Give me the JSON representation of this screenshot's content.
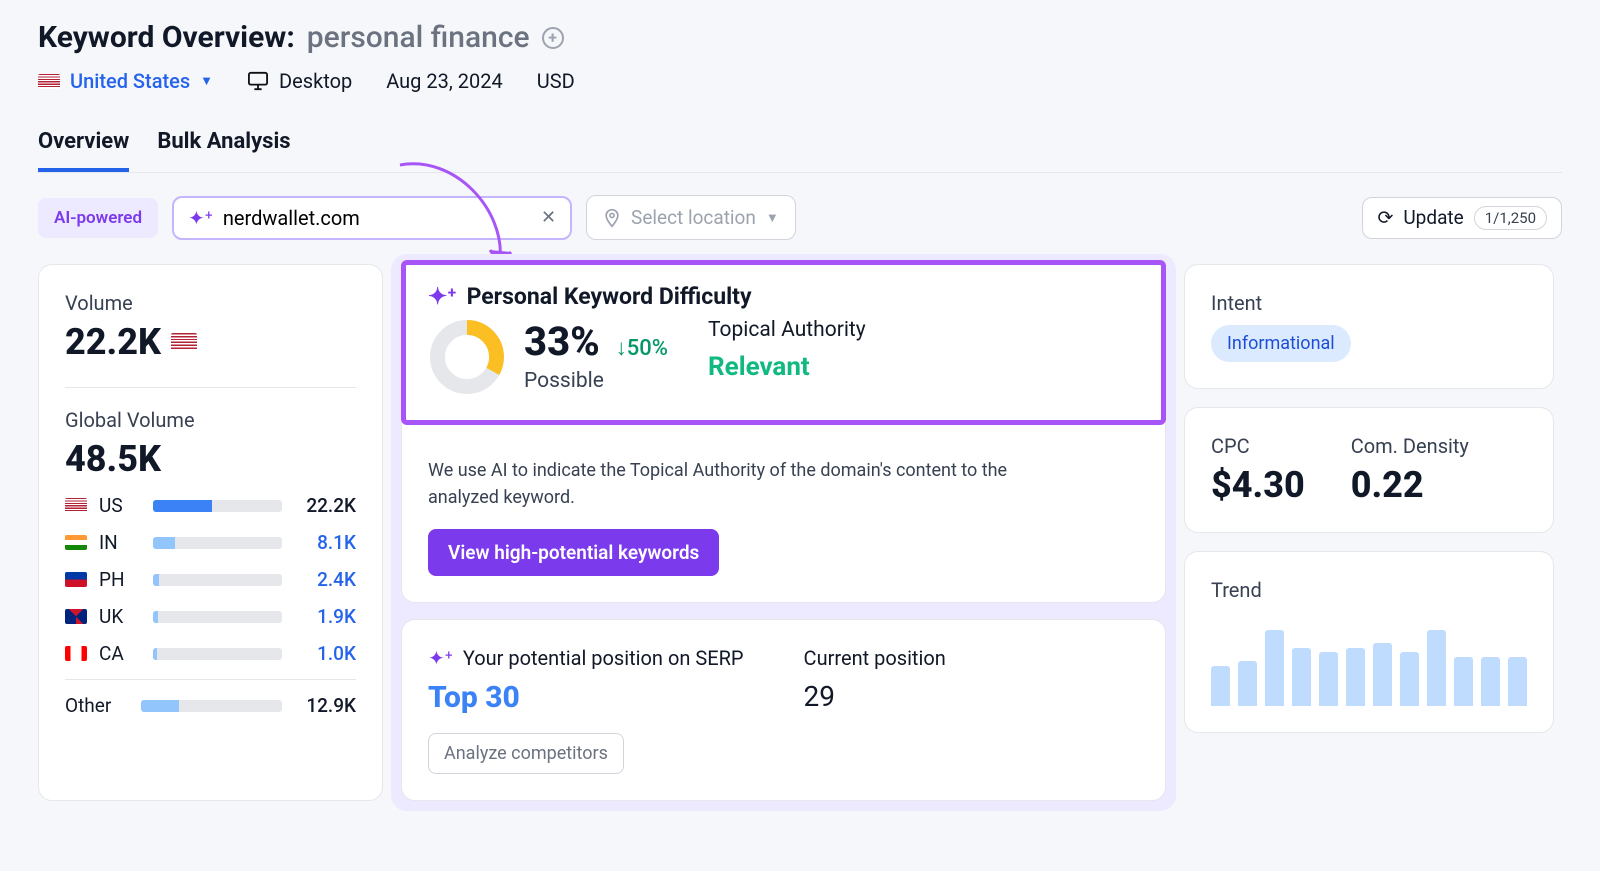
{
  "header": {
    "title_prefix": "Keyword Overview:",
    "keyword": "personal finance",
    "country": "United States",
    "device": "Desktop",
    "date": "Aug 23, 2024",
    "currency": "USD"
  },
  "tabs": {
    "overview": "Overview",
    "bulk": "Bulk Analysis"
  },
  "controls": {
    "ai_label": "AI-powered",
    "domain_value": "nerdwallet.com",
    "location_placeholder": "Select location",
    "update_label": "Update",
    "update_count": "1/1,250"
  },
  "volume": {
    "label": "Volume",
    "value": "22.2K",
    "global_label": "Global Volume",
    "global_value": "48.5K",
    "rows": [
      {
        "cc": "US",
        "val": "22.2K",
        "pct": 46
      },
      {
        "cc": "IN",
        "val": "8.1K",
        "pct": 17
      },
      {
        "cc": "PH",
        "val": "2.4K",
        "pct": 5
      },
      {
        "cc": "UK",
        "val": "1.9K",
        "pct": 4
      },
      {
        "cc": "CA",
        "val": "1.0K",
        "pct": 3
      }
    ],
    "other_label": "Other",
    "other_val": "12.9K",
    "other_pct": 27
  },
  "pkd": {
    "title": "Personal Keyword Difficulty",
    "percent": "33%",
    "delta": "↓50%",
    "rating": "Possible",
    "donut_offset": 33,
    "ta_title": "Topical Authority",
    "ta_value": "Relevant",
    "ai_note": "We use AI to indicate the Topical Authority of the domain's content to the analyzed keyword.",
    "view_btn": "View high-potential keywords"
  },
  "serp": {
    "pot_title": "Your potential position on SERP",
    "pot_value": "Top 30",
    "cur_title": "Current position",
    "cur_value": "29",
    "analyze_btn": "Analyze competitors"
  },
  "intent": {
    "title": "Intent",
    "value": "Informational"
  },
  "cpc": {
    "cpc_label": "CPC",
    "cpc_value": "$4.30",
    "cd_label": "Com. Density",
    "cd_value": "0.22"
  },
  "trend": {
    "title": "Trend"
  },
  "chart_data": {
    "type": "bar",
    "title": "Trend",
    "values": [
      45,
      50,
      85,
      65,
      60,
      65,
      70,
      60,
      85,
      55,
      55,
      55
    ],
    "ylim": [
      0,
      100
    ]
  },
  "flags": {
    "US": "linear-gradient(180deg,#b22234 0 8%,#fff 8% 16%,#b22234 16% 24%,#fff 24% 32%,#b22234 32% 40%,#fff 40% 48%,#b22234 48% 56%,#fff 56% 64%,#b22234 64% 72%,#fff 72% 80%,#b22234 80% 88%,#fff 88% 100%)",
    "IN": "linear-gradient(180deg,#ff9933 0 33%,#fff 33% 66%,#138808 66% 100%)",
    "PH": "linear-gradient(180deg,#0038a8 0 50%,#ce1126 50% 100%)",
    "UK": "conic-gradient(#cf142b 0 12%,#00247d 12% 38%,#cf142b 38% 50%,#00247d 50% 88%,#cf142b 88% 100%)",
    "CA": "linear-gradient(90deg,#ff0000 0 25%,#fff 25% 75%,#ff0000 75% 100%)"
  }
}
